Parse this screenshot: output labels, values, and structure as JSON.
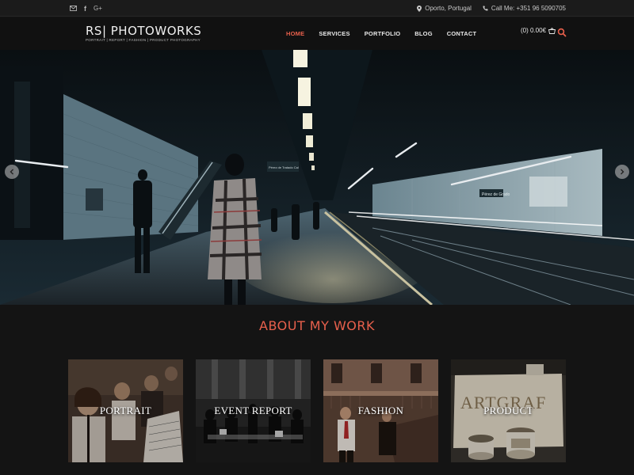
{
  "topbar": {
    "icons": [
      "mail-icon",
      "facebook-icon",
      "google-plus-icon"
    ],
    "google_plus_text": "G+",
    "location": "Oporto, Portugal",
    "phone": "Call Me: +351 96 5090705"
  },
  "header": {
    "logo_name": "RS| PHOTOWORKS",
    "logo_tagline": "PORTRAIT | REPORT | FASHION | PRODUCT PHOTOGRAPHY",
    "nav": [
      "HOME",
      "SERVICES",
      "PORTFOLIO",
      "BLOG",
      "CONTACT"
    ],
    "active_nav": "HOME",
    "cart": "(0) 0.00€"
  },
  "hero": {
    "sign_text_1": "Pérez de Tratado Cal",
    "sign_text_2": "Pérez de Grado"
  },
  "about": {
    "title": "ABOUT MY WORK",
    "tiles": [
      {
        "label": "PORTRAIT"
      },
      {
        "label": "EVENT REPORT"
      },
      {
        "label": "FASHION"
      },
      {
        "label": "PRODUCT"
      }
    ],
    "product_sign": "ARTGRAF"
  },
  "colors": {
    "accent": "#e8604c",
    "background": "#141414",
    "header": "#111111"
  }
}
